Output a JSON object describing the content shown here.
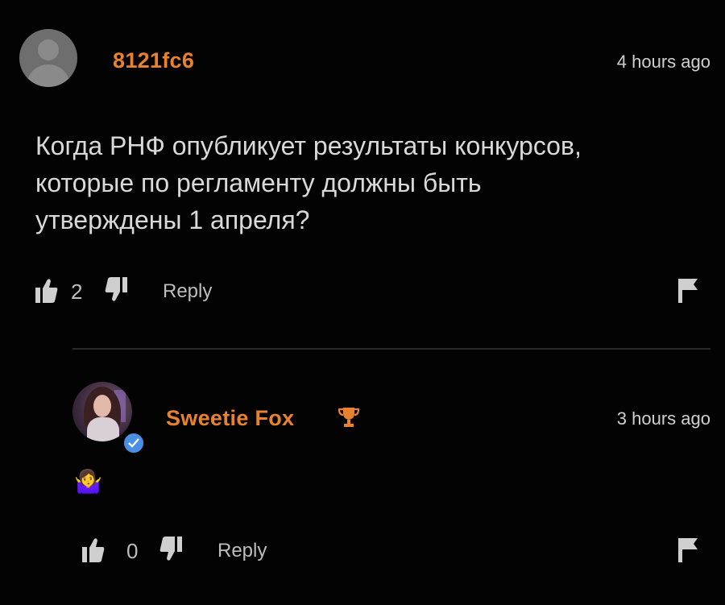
{
  "comments": [
    {
      "username": "8121fc6",
      "time": "4 hours ago",
      "text": "Когда РНФ опубликует результаты конкурсов, которые по регламенту должны быть утверждены 1 апреля?",
      "text_lines": [
        "Когда РНФ опубликует результаты конкурсов,",
        "которые по регламенту должны быть",
        "утверждены 1 апреля?"
      ],
      "likes": "2",
      "reply_label": "Reply",
      "avatar": "default-avatar-icon"
    },
    {
      "username": "Sweetie Fox",
      "time": "3 hours ago",
      "text": "🤷‍♀️",
      "likes": "0",
      "reply_label": "Reply",
      "avatar": "user-photo",
      "badge_icon": "trophy-icon",
      "verified_icon": "verified-check-icon"
    }
  ],
  "colors": {
    "background": "#030303",
    "username": "#e8822f",
    "text": "#d9d9d9",
    "muted": "#bdbdbd",
    "verified": "#4a90e2"
  }
}
